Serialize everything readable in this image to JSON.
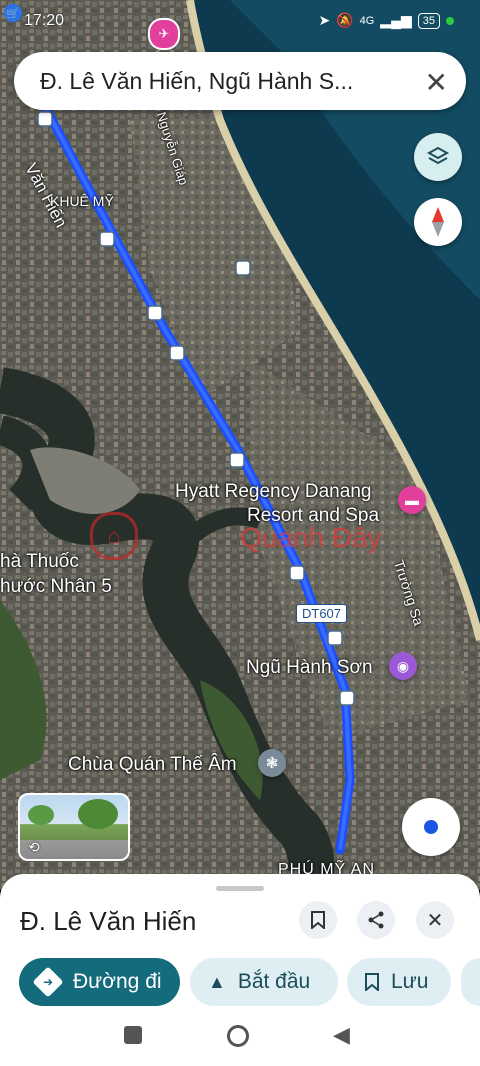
{
  "status_bar": {
    "time": "17:20",
    "network": "4G",
    "battery": "35"
  },
  "search": {
    "query": "Đ. Lê Văn Hiến, Ngũ Hành S...",
    "close_icon": "close-icon"
  },
  "map": {
    "labels": {
      "road_le_van_hien": "Văn Hiến",
      "khue_my": "KHUÊ MỸ",
      "nguyen_giap": "Nguyễn Giáp",
      "hyatt": "Hyatt Regency Danang",
      "hyatt_line2": "Resort and Spa",
      "nha_thuoc": "hà Thuốc",
      "nha_thuoc_line2": "hước Nhân 5",
      "watermark": "Quanh Đây",
      "dt607": "DT607",
      "truong_sa": "Trường Sa",
      "ngu_hanh_son": "Ngũ Hành Sơn",
      "chua": "Chùa Quán Thế Âm",
      "phu_my_an": "PHÚ MỸ AN"
    },
    "route_color": "#1a4fff",
    "sea_color": "#0e3a4f"
  },
  "sheet": {
    "title": "Đ. Lê Văn Hiến",
    "chips": {
      "directions": "Đường đi",
      "start": "Bắt đầu",
      "save": "Lưu"
    }
  }
}
